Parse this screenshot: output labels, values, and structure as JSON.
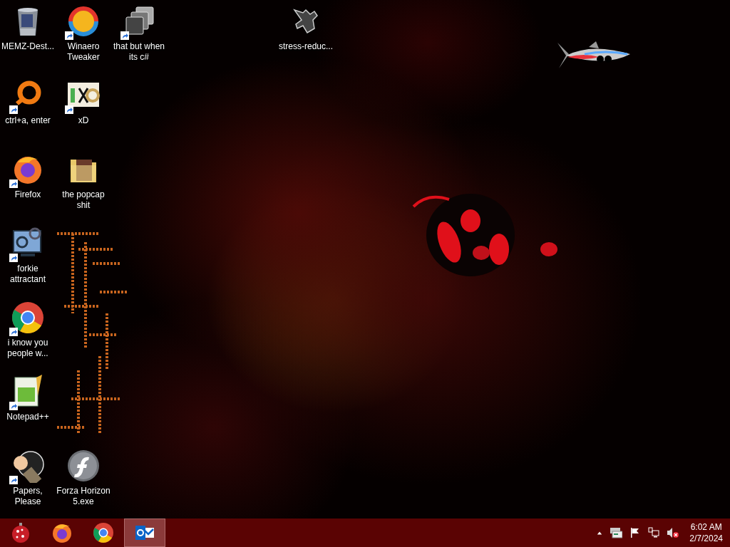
{
  "desktop": {
    "icons": [
      {
        "label": "MEMZ-Dest...",
        "kind": "recycle-bin",
        "shortcut": false
      },
      {
        "label": "ctrl+a, enter",
        "kind": "ring",
        "shortcut": true
      },
      {
        "label": "Firefox",
        "kind": "firefox",
        "shortcut": true
      },
      {
        "label": "forkie attractant",
        "kind": "gear-monitor",
        "shortcut": true
      },
      {
        "label": "i know you people w...",
        "kind": "chrome",
        "shortcut": true
      },
      {
        "label": "Notepad++",
        "kind": "notepad",
        "shortcut": true
      },
      {
        "label": "Papers, Please",
        "kind": "hand",
        "shortcut": true
      },
      {
        "label": "Winaero Tweaker",
        "kind": "swirl",
        "shortcut": true
      },
      {
        "label": "xD",
        "kind": "hex",
        "shortcut": true
      },
      {
        "label": "the popcap shit",
        "kind": "folder",
        "shortcut": false
      },
      {
        "label": "Forza Horizon 5.exe",
        "kind": "flash",
        "shortcut": false
      },
      {
        "label": "that but when its c#",
        "kind": "stack",
        "shortcut": true
      },
      {
        "label": "stress-reduc...",
        "kind": "blob",
        "shortcut": false
      }
    ]
  },
  "taskbar": {
    "items": [
      {
        "kind": "start",
        "selected": false
      },
      {
        "kind": "firefox",
        "selected": false
      },
      {
        "kind": "chrome",
        "selected": false
      },
      {
        "kind": "outlook",
        "selected": true
      }
    ],
    "tray": [
      {
        "kind": "chevron"
      },
      {
        "kind": "mail"
      },
      {
        "kind": "flag"
      },
      {
        "kind": "network"
      },
      {
        "kind": "speaker-muted"
      }
    ],
    "clock": {
      "time": "6:02 AM",
      "date": "2/7/2024"
    }
  }
}
